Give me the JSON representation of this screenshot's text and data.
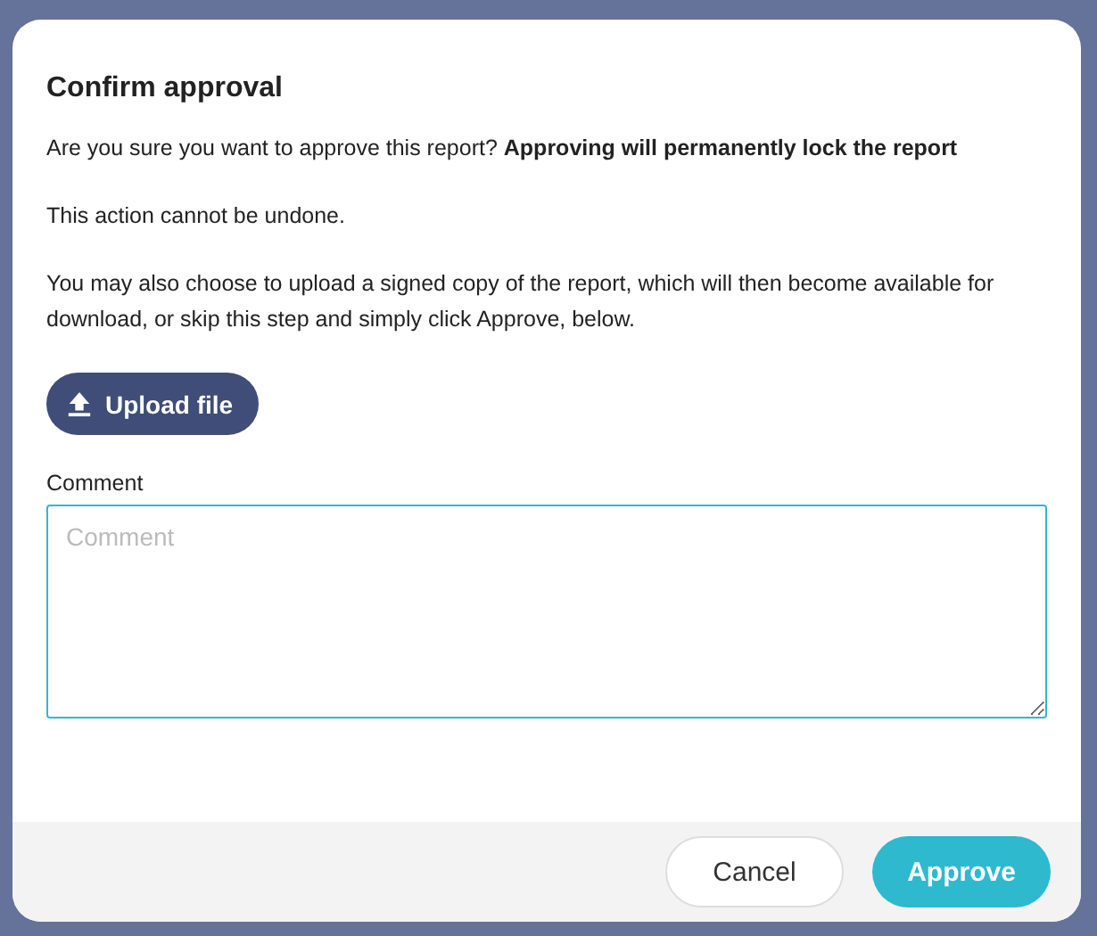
{
  "dialog": {
    "title": "Confirm approval",
    "paragraphs": [
      "Are you sure you want to approve this report? **Approving will permanently lock the report**",
      "This action cannot be undone.",
      "You may also choose to upload a signed copy of the report, which will then become available for download, or skip this step and simply click Approve, below."
    ],
    "upload_button": "Upload file",
    "comment": {
      "label": "Comment",
      "placeholder": "Comment"
    },
    "buttons": [
      {
        "label": "Cancel",
        "kind": "secondary"
      },
      {
        "label": "Approve",
        "kind": "primary"
      }
    ]
  }
}
